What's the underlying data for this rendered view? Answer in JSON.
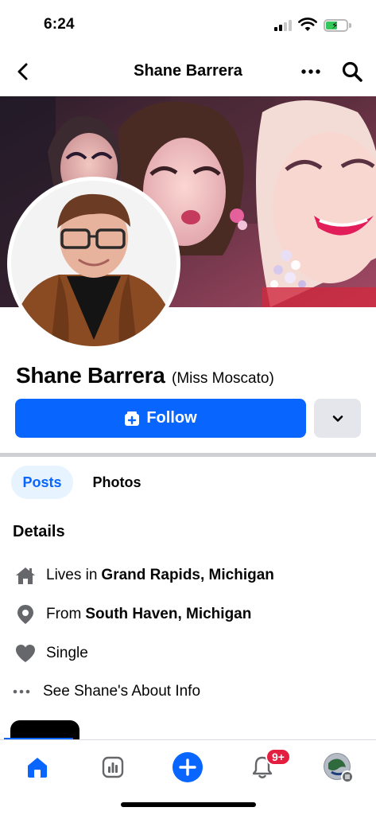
{
  "status_bar": {
    "time": "6:24"
  },
  "header": {
    "title": "Shane Barrera"
  },
  "profile": {
    "name": "Shane Barrera",
    "alt_name": "(Miss Moscato)",
    "follow_label": "Follow"
  },
  "tabs": [
    {
      "label": "Posts",
      "active": true
    },
    {
      "label": "Photos",
      "active": false
    }
  ],
  "details": {
    "heading": "Details",
    "lives_prefix": "Lives in",
    "lives_place": "Grand Rapids, Michigan",
    "from_prefix": "From",
    "from_place": "South Haven, Michigan",
    "relationship": "Single",
    "see_about": "See Shane's About Info"
  },
  "bottom_nav": {
    "items": [
      "home-icon",
      "dashboard-icon",
      "create-icon",
      "notifications-icon",
      "profile-avatar"
    ],
    "notification_badge": "9+"
  },
  "colors": {
    "accent": "#0866ff",
    "badge": "#e41e3f",
    "tab_active_bg": "#e7f3ff",
    "secondary_button": "#e4e6eb"
  }
}
